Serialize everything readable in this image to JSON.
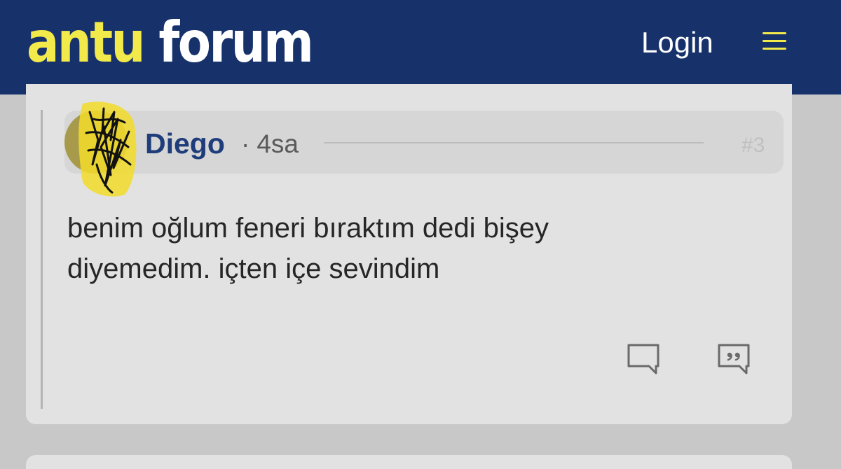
{
  "header": {
    "logo_part1": "antu",
    "logo_part2": "forum",
    "login_label": "Login",
    "menu_icon": "hamburger-menu-icon"
  },
  "colors": {
    "header_bg": "#17326b",
    "brand_yellow": "#f2e94a",
    "username": "#1f3d7a",
    "card_bg": "#e2e2e2",
    "page_bg": "#c8c8c8"
  },
  "post": {
    "username": "Diego",
    "dot": "·",
    "time": "4sa",
    "post_number": "#3",
    "body_line1": "benim oğlum feneri bıraktım dedi bişey",
    "body_line2": "diyemedim. içten içe sevindim",
    "actions": {
      "reply_icon": "comment-bubble-icon",
      "quote_icon": "quote-bubble-icon"
    }
  }
}
